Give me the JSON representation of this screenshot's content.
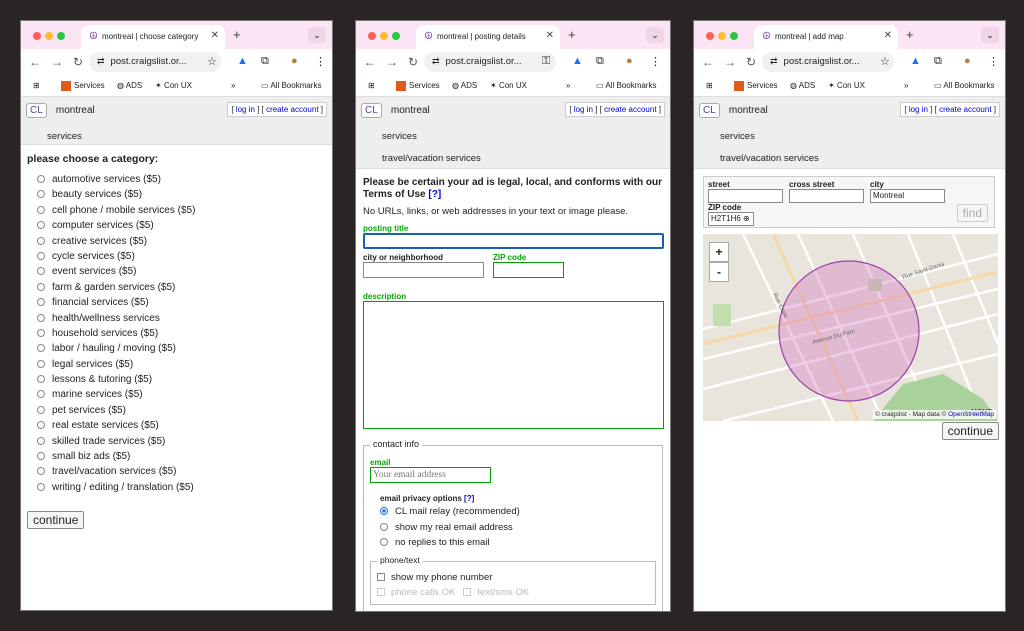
{
  "browser": {
    "address": "post.craigslist.or...",
    "bookmarks": [
      "Services",
      "ADS",
      "Con UX"
    ],
    "more": "»",
    "all_bookmarks": "All Bookmarks"
  },
  "header": {
    "logo": "CL",
    "site": "montreal",
    "login": "log in",
    "create": "create account"
  },
  "window1": {
    "tab_title": "montreal | choose category",
    "breadcrumb": "services",
    "heading": "please choose a category:",
    "categories": [
      "automotive services ($5)",
      "beauty services ($5)",
      "cell phone / mobile services ($5)",
      "computer services ($5)",
      "creative services ($5)",
      "cycle services ($5)",
      "event services ($5)",
      "farm & garden services ($5)",
      "financial services ($5)",
      "health/wellness services",
      "household services ($5)",
      "labor / hauling / moving ($5)",
      "legal services ($5)",
      "lessons & tutoring ($5)",
      "marine services ($5)",
      "pet services ($5)",
      "real estate services ($5)",
      "skilled trade services ($5)",
      "small biz ads ($5)",
      "travel/vacation services ($5)",
      "writing / editing / translation ($5)"
    ],
    "continue": "continue"
  },
  "window2": {
    "tab_title": "montreal | posting details",
    "breadcrumbs": [
      "services",
      "travel/vacation services"
    ],
    "warning": "Please be certain your ad is legal, local, and conforms with our Terms of Use",
    "help": "[?]",
    "no_urls": "No URLs, links, or web addresses in your text or image please.",
    "posting_title": "posting title",
    "city": "city or neighborhood",
    "zip": "ZIP code",
    "description": "description",
    "contact_info": "contact info",
    "email": "email",
    "email_placeholder": "Your email address",
    "privacy": "email privacy options",
    "privacy_options": [
      "CL mail relay (recommended)",
      "show my real email address",
      "no replies to this email"
    ],
    "phone_text": "phone/text",
    "show_phone": "show my phone number",
    "phone_calls": "phone calls OK",
    "text_ok": "text/sms OK"
  },
  "window3": {
    "tab_title": "montreal | add map",
    "breadcrumbs": [
      "services",
      "travel/vacation services"
    ],
    "street": "street",
    "cross_street": "cross street",
    "city_label": "city",
    "city_value": "Montreal",
    "zip_label": "ZIP code",
    "zip_value": "H2T1H6",
    "find": "find",
    "zoom_in": "+",
    "zoom_out": "-",
    "attribution": "© craigslist - Map data ©",
    "osm": "OpenStreetMap",
    "continue": "continue"
  },
  "colors": {
    "tabbar": "#fbe4f4",
    "link": "#0000cc",
    "field_green": "#00a000",
    "radius": "#b070c0"
  }
}
